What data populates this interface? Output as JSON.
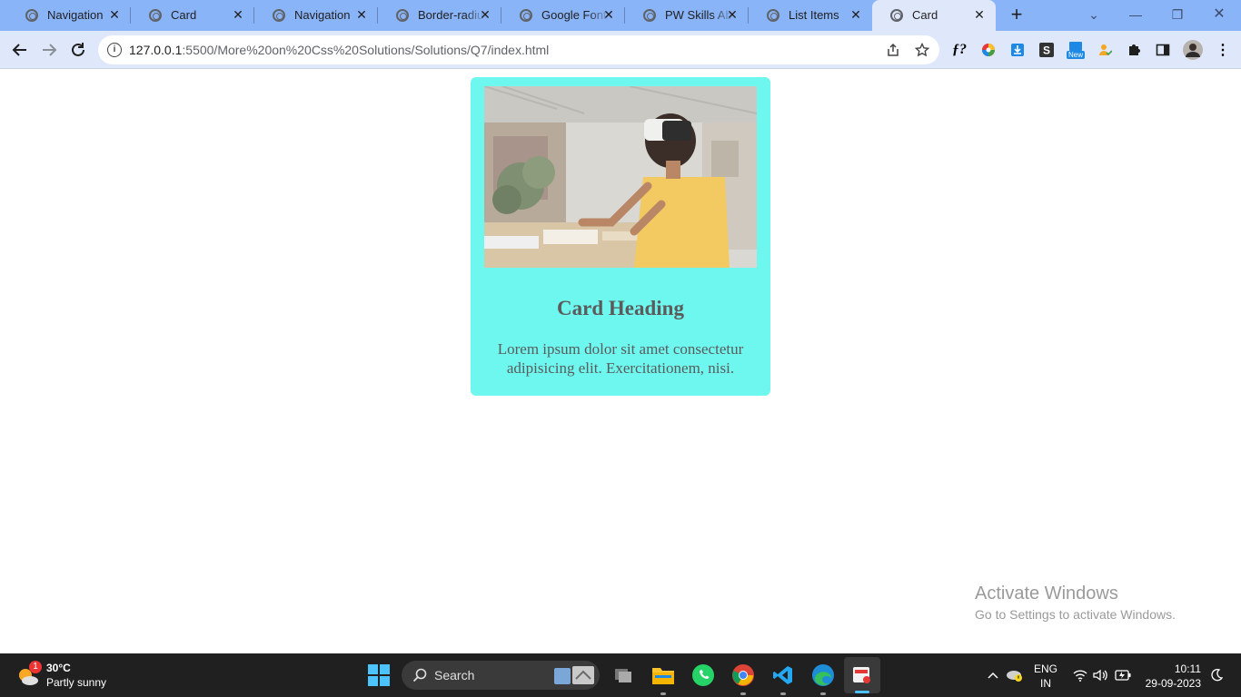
{
  "browser": {
    "tabs": [
      {
        "title": "Navigation"
      },
      {
        "title": "Card"
      },
      {
        "title": "Navigation"
      },
      {
        "title": "Border-radius"
      },
      {
        "title": "Google Fonts"
      },
      {
        "title": "PW Skills About"
      },
      {
        "title": "List Items"
      },
      {
        "title": "Card"
      }
    ],
    "active_tab_index": 7,
    "new_tab_label": "+",
    "address_bar": {
      "host": "127.0.0.1",
      "path": ":5500/More%20on%20Css%20Solutions/Solutions/Q7/index.html"
    },
    "extension_new_badge": "New"
  },
  "page": {
    "card": {
      "heading": "Card Heading",
      "text": "Lorem ipsum dolor sit amet consectetur adipisicing elit. Exercitationem, nisi.",
      "background_color": "#6ef7ef"
    }
  },
  "watermark": {
    "title": "Activate Windows",
    "subtitle": "Go to Settings to activate Windows."
  },
  "taskbar": {
    "weather": {
      "badge": "1",
      "temperature": "30°C",
      "condition": "Partly sunny"
    },
    "search_label": "Search",
    "language": {
      "line1": "ENG",
      "line2": "IN"
    },
    "clock": {
      "time": "10:11",
      "date": "29-09-2023"
    }
  }
}
